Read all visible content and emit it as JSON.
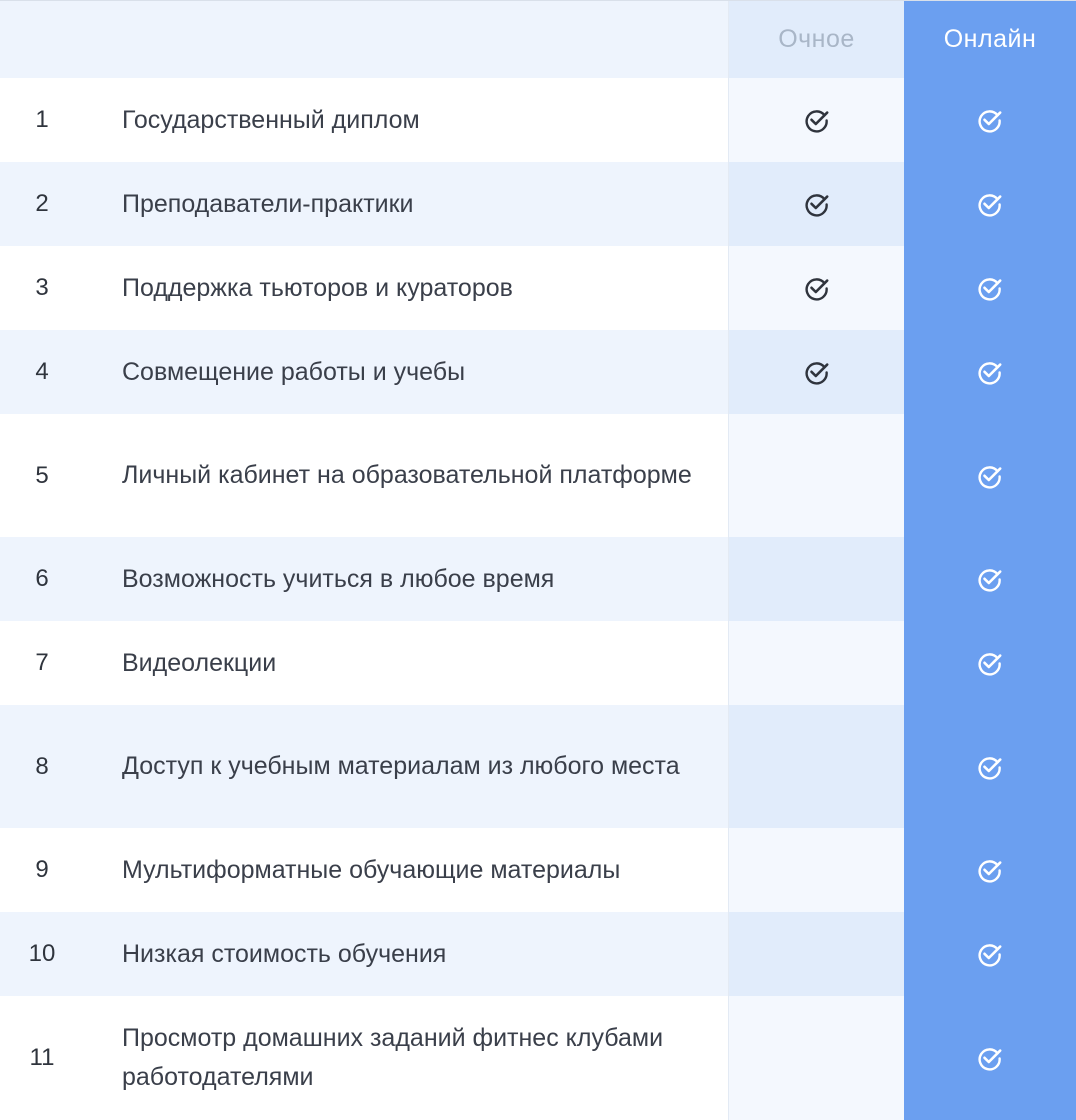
{
  "header": {
    "col_offline": "Очное",
    "col_online": "Онлайн"
  },
  "rows": [
    {
      "num": "1",
      "label": "Государственный диплом",
      "offline": true,
      "online": true
    },
    {
      "num": "2",
      "label": "Преподаватели-практики",
      "offline": true,
      "online": true
    },
    {
      "num": "3",
      "label": "Поддержка тьюторов и кураторов",
      "offline": true,
      "online": true
    },
    {
      "num": "4",
      "label": "Совмещение работы и учебы",
      "offline": true,
      "online": true
    },
    {
      "num": "5",
      "label": "Личный кабинет на образовательной платформе",
      "offline": false,
      "online": true
    },
    {
      "num": "6",
      "label": "Возможность учиться в любое время",
      "offline": false,
      "online": true
    },
    {
      "num": "7",
      "label": "Видеолекции",
      "offline": false,
      "online": true
    },
    {
      "num": "8",
      "label": "Доступ к учебным материалам из любого места",
      "offline": false,
      "online": true
    },
    {
      "num": "9",
      "label": "Мультиформатные обучающие материалы",
      "offline": false,
      "online": true
    },
    {
      "num": "10",
      "label": "Низкая стоимость обучения",
      "offline": false,
      "online": true
    },
    {
      "num": "11",
      "label": "Просмотр домашних заданий фитнес клубами работодателями",
      "offline": false,
      "online": true
    }
  ],
  "colors": {
    "online_column": "#6b9ff0",
    "row_alt": "#eef4fd",
    "check_dark": "#2f343d",
    "check_light": "#ffffff"
  },
  "icons": {
    "check": "check-circle-icon"
  }
}
